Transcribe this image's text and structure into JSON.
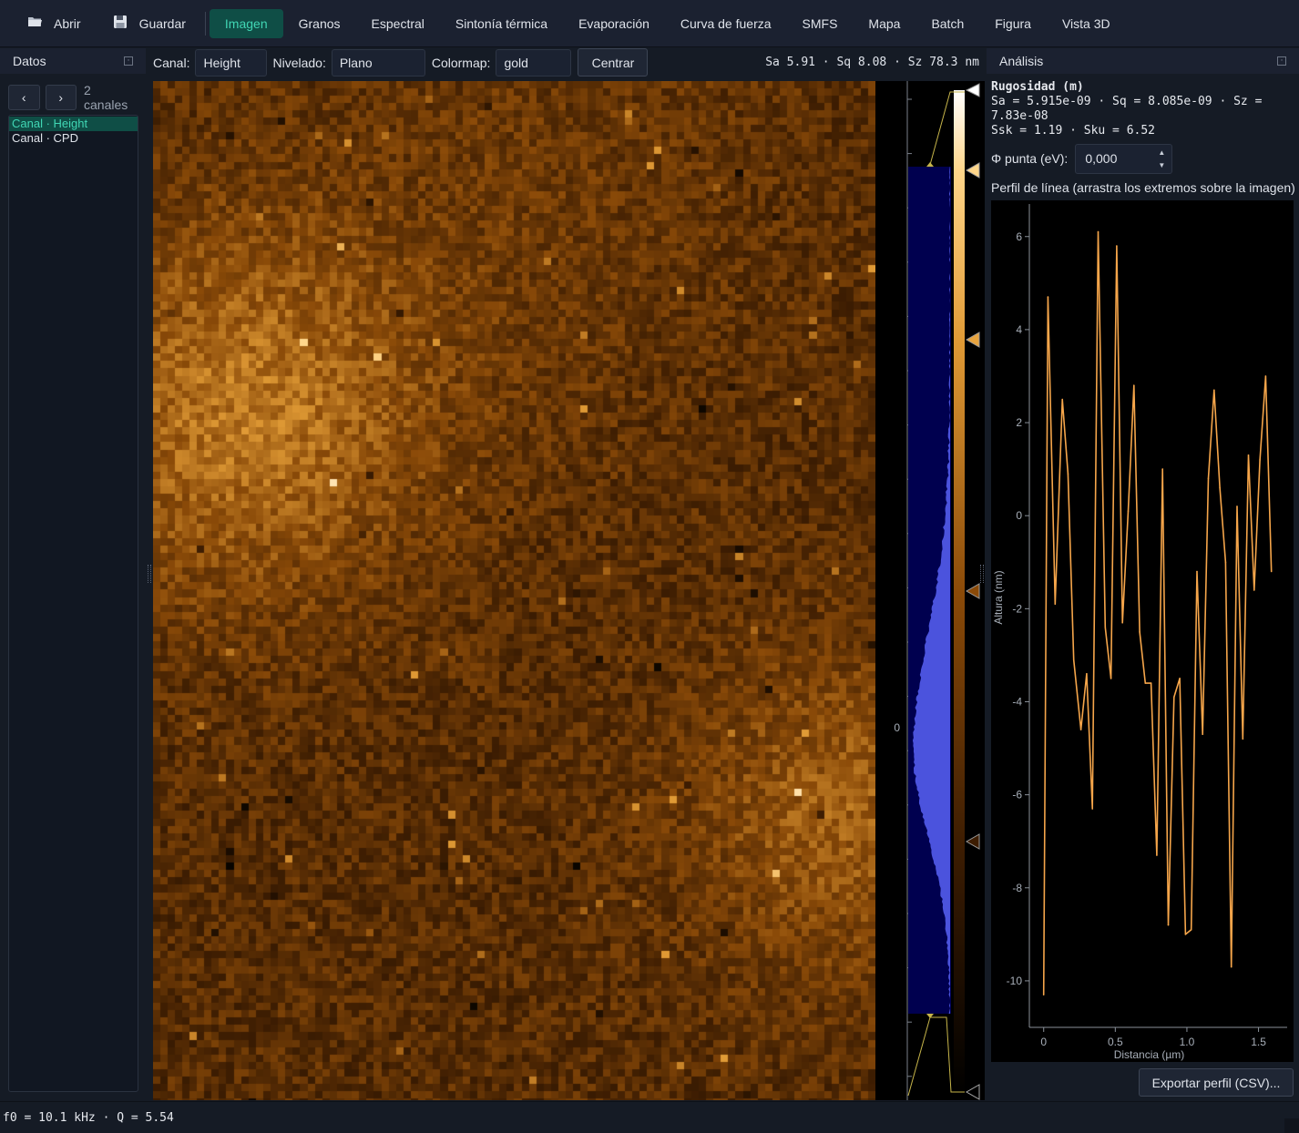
{
  "toolbar": {
    "open_label": "Abrir",
    "open_icon": "folder-icon",
    "save_label": "Guardar",
    "save_icon": "floppy-disk-icon",
    "tabs": [
      {
        "label": "Imagen",
        "active": true
      },
      {
        "label": "Granos"
      },
      {
        "label": "Espectral"
      },
      {
        "label": "Sintonía térmica"
      },
      {
        "label": "Evaporación"
      },
      {
        "label": "Curva de fuerza"
      },
      {
        "label": "SMFS"
      },
      {
        "label": "Mapa"
      },
      {
        "label": "Batch"
      },
      {
        "label": "Figura"
      },
      {
        "label": "Vista 3D"
      }
    ],
    "accent_color": "#40d6b4",
    "active_bg": "#0f4e46"
  },
  "left_dock": {
    "title": "Datos",
    "prev_label": "‹",
    "next_label": "›",
    "count_text": "2 canales",
    "channels": [
      {
        "label": "Canal · Height",
        "selected": true
      },
      {
        "label": "Canal · CPD"
      }
    ]
  },
  "image_toolbar": {
    "channel_label": "Canal:",
    "channel_value": "Height",
    "leveling_label": "Nivelado:",
    "leveling_value": "Plano",
    "colormap_label": "Colormap:",
    "colormap_value": "gold",
    "center_label": "Centrar",
    "stats_text": "Sa 5.91 · Sq 8.08 · Sz 78.3 nm"
  },
  "histogram": {
    "zero_label": "0",
    "fill_color": "#000055",
    "curve_color": "#4d55e0"
  },
  "right_dock": {
    "title": "Análisis",
    "roughness_title": "Rugosidad (m)",
    "roughness_line1": "Sa = 5.915e-09 · Sq = 8.085e-09 · Sz =",
    "roughness_line2": "7.83e-08",
    "roughness_line3": "Ssk = 1.19 · Sku = 6.52",
    "phi_label": "Φ punta (eV):",
    "phi_value": "0,000",
    "profile_title": "Perfil de línea (arrastra los extremos sobre la imagen)",
    "export_label": "Exportar perfil (CSV)..."
  },
  "chart_data": {
    "type": "line",
    "title": "",
    "xlabel": "Distancia (µm)",
    "ylabel": "Altura (nm)",
    "xlim": [
      -0.1,
      1.7
    ],
    "ylim": [
      -11,
      6.7
    ],
    "xticks": [
      0,
      0.5,
      1.0,
      1.5
    ],
    "xtick_labels": [
      "0",
      "0.5",
      "1.0",
      "1.5"
    ],
    "yticks": [
      6,
      4,
      2,
      0,
      -2,
      -4,
      -6,
      -8,
      -10
    ],
    "line_color": "#f5a54a",
    "grid": false,
    "series": [
      {
        "x": [
          0,
          0.03,
          0.08,
          0.13,
          0.17,
          0.21,
          0.26,
          0.3,
          0.34,
          0.38,
          0.43,
          0.47,
          0.51,
          0.55,
          0.59,
          0.63,
          0.67,
          0.71,
          0.75,
          0.79,
          0.83,
          0.87,
          0.91,
          0.95,
          0.99,
          1.03,
          1.07,
          1.11,
          1.15,
          1.19,
          1.23,
          1.27,
          1.31,
          1.35,
          1.39,
          1.43,
          1.47,
          1.51,
          1.55,
          1.59
        ],
        "values": [
          -10.3,
          4.7,
          -1.9,
          2.5,
          0.9,
          -3.1,
          -4.6,
          -3.4,
          -6.3,
          6.1,
          -2.4,
          -3.5,
          5.8,
          -2.3,
          0.1,
          2.8,
          -2.5,
          -3.6,
          -3.6,
          -7.3,
          1.0,
          -8.8,
          -3.9,
          -3.5,
          -9.0,
          -8.9,
          -1.2,
          -4.7,
          0.8,
          2.7,
          0.6,
          -1.0,
          -9.7,
          0.2,
          -4.8,
          1.3,
          -1.6,
          1.2,
          3.0,
          -1.2
        ]
      }
    ]
  },
  "status": {
    "text": "f0 = 10.1 kHz · Q = 5.54"
  }
}
